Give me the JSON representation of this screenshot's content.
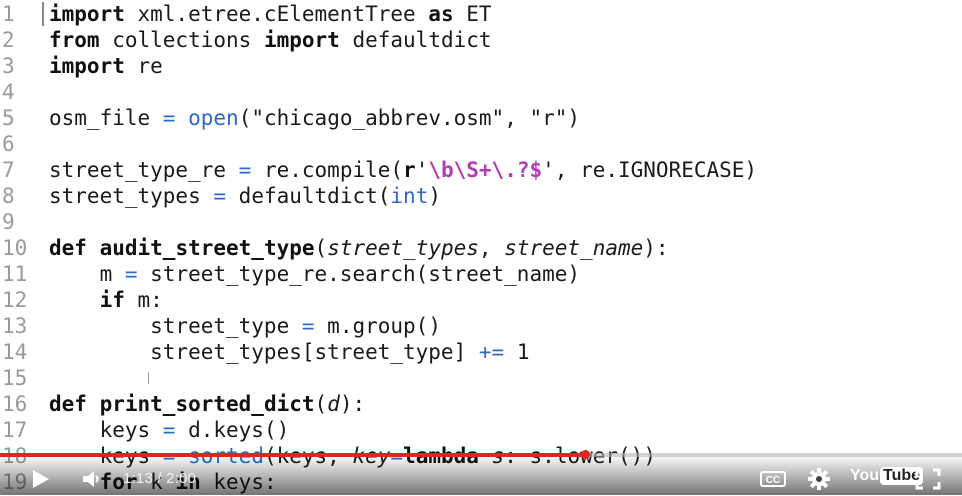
{
  "code": {
    "line_numbers": [
      "1",
      "2",
      "3",
      "4",
      "5",
      "6",
      "7",
      "8",
      "9",
      "10",
      "11",
      "12",
      "13",
      "14",
      "15",
      "16",
      "17",
      "18",
      "19"
    ]
  },
  "player": {
    "current_time": "1:13",
    "duration": "2:00",
    "time_separator": "/",
    "progress_fraction": 0.608,
    "cc_label": "CC",
    "youtube_text": "You",
    "youtube_box_text": "Tube",
    "accent_color": "#e32222"
  }
}
